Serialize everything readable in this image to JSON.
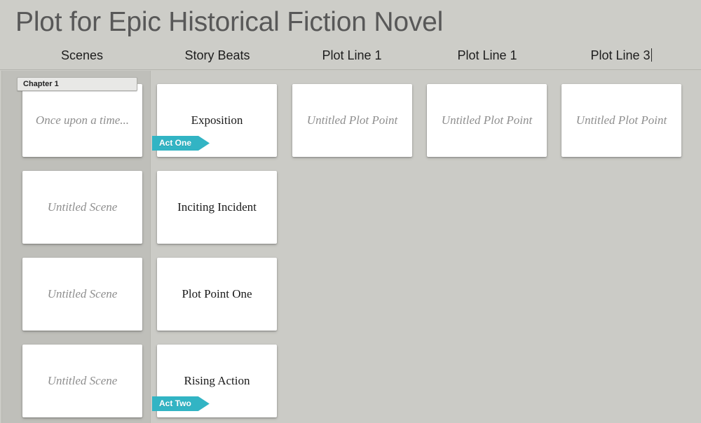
{
  "header": {
    "title": "Plot for Epic Historical Fiction Novel",
    "columns": [
      {
        "label": "Scenes",
        "editing": false,
        "center": 117
      },
      {
        "label": "Story Beats",
        "editing": false,
        "center": 310
      },
      {
        "label": "Plot Line 1",
        "editing": false,
        "center": 502
      },
      {
        "label": "Plot Line 1",
        "editing": false,
        "center": 695
      },
      {
        "label": "Plot Line 3",
        "editing": true,
        "center": 886
      }
    ]
  },
  "board": {
    "chapter_tab": {
      "label": "Chapter 1"
    },
    "colors": {
      "canvas_background": "#cbcbc6",
      "scenes_track": "#bfbfba",
      "header_background": "#cdcdc8",
      "card_background": "#ffffff",
      "act_badge": "#32b4c4",
      "title_text": "#585858",
      "card_text": "#1a1a1a",
      "placeholder_text": "#8e8e8e"
    },
    "columns": [
      {
        "name": "scenes",
        "cards": [
          {
            "text": "Once upon a time...",
            "placeholder": true,
            "badge": null
          },
          {
            "text": "Untitled Scene",
            "placeholder": true,
            "badge": null
          },
          {
            "text": "Untitled Scene",
            "placeholder": true,
            "badge": null
          },
          {
            "text": "Untitled Scene",
            "placeholder": true,
            "badge": null
          }
        ]
      },
      {
        "name": "story-beats",
        "cards": [
          {
            "text": "Exposition",
            "placeholder": false,
            "badge": "Act One"
          },
          {
            "text": "Inciting Incident",
            "placeholder": false,
            "badge": null
          },
          {
            "text": "Plot Point One",
            "placeholder": false,
            "badge": null
          },
          {
            "text": "Rising Action",
            "placeholder": false,
            "badge": "Act Two"
          }
        ]
      },
      {
        "name": "plot-line-1",
        "cards": [
          {
            "text": "Untitled Plot Point",
            "placeholder": true,
            "badge": null
          }
        ]
      },
      {
        "name": "plot-line-2",
        "cards": [
          {
            "text": "Untitled Plot Point",
            "placeholder": true,
            "badge": null
          }
        ]
      },
      {
        "name": "plot-line-3",
        "cards": [
          {
            "text": "Untitled Plot Point",
            "placeholder": true,
            "badge": null
          }
        ]
      }
    ]
  }
}
